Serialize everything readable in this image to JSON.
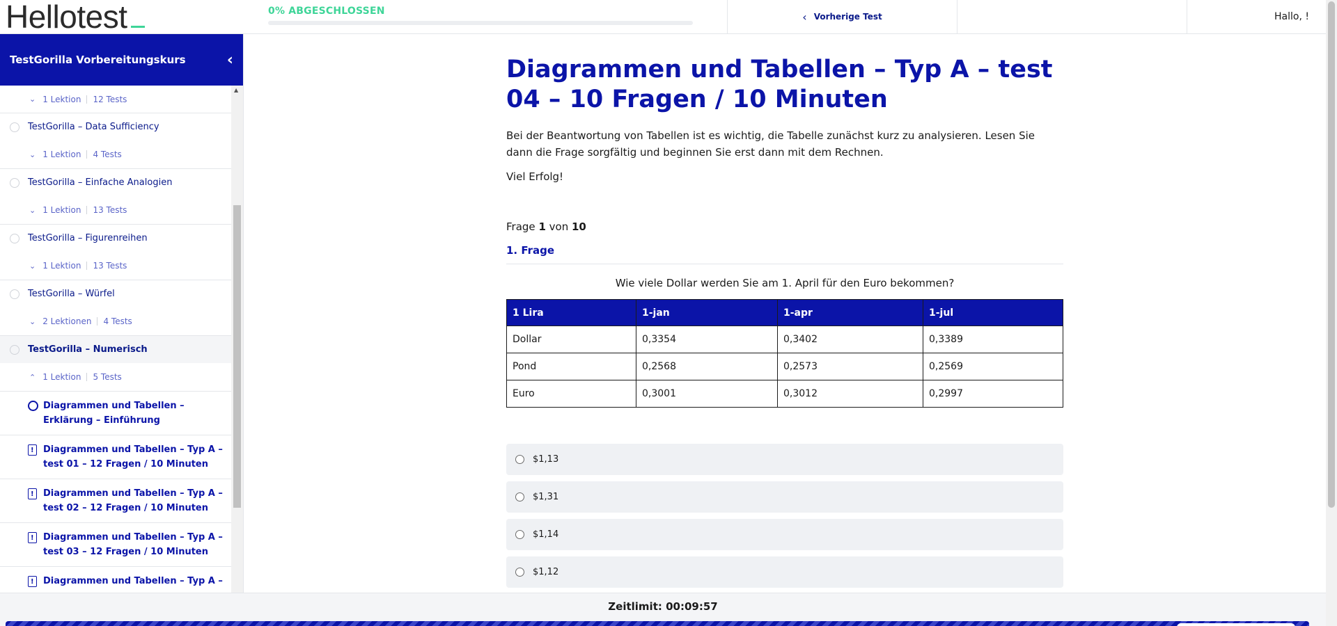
{
  "header": {
    "logo_text": "Hellotest",
    "progress_label": "0% ABGESCHLOSSEN",
    "progress_value": 0,
    "prev_test_label": "Vorherige Test",
    "greeting": "Hallo, !"
  },
  "sidebar": {
    "title": "TestGorilla Vorbereitungskurs",
    "first_meta": {
      "lessons": "1 Lektion",
      "tests": "12 Tests"
    },
    "sections": [
      {
        "title": "TestGorilla – Data Sufficiency",
        "lessons": "1 Lektion",
        "tests": "4 Tests"
      },
      {
        "title": "TestGorilla – Einfache Analogien",
        "lessons": "1 Lektion",
        "tests": "13 Tests"
      },
      {
        "title": "TestGorilla – Figurenreihen",
        "lessons": "1 Lektion",
        "tests": "13 Tests"
      },
      {
        "title": "TestGorilla – Würfel",
        "lessons": "2 Lektionen",
        "tests": "4 Tests"
      },
      {
        "title": "TestGorilla – Numerisch",
        "lessons": "1 Lektion",
        "tests": "5 Tests"
      }
    ],
    "lessons": [
      "Diagrammen und Tabellen – Erklärung – Einführung",
      "Diagrammen und Tabellen – Typ A – test 01 – 12 Fragen / 10 Minuten",
      "Diagrammen und Tabellen – Typ A – test 02 – 12 Fragen / 10 Minuten",
      "Diagrammen und Tabellen – Typ A – test 03 – 12 Fragen / 10 Minuten",
      "Diagrammen und Tabellen – Typ A –"
    ]
  },
  "main": {
    "title": "Diagrammen und Tabellen – Typ A – test 04 – 10 Fragen / 10 Minuten",
    "intro": "Bei der Beantwortung von Tabellen ist es wichtig, die Tabelle zunächst kurz zu analysieren. Lesen Sie dann die Frage sorgfältig und beginnen Sie erst dann mit dem Rechnen.",
    "good_luck": "Viel Erfolg!",
    "counter_prefix": "Frage",
    "counter_current": "1",
    "counter_mid": "von",
    "counter_total": "10",
    "question_heading": "1. Frage",
    "question_text": "Wie viele Dollar werden Sie am 1. April für den Euro bekommen?",
    "table": {
      "headers": [
        "1 Lira",
        "1-jan",
        "1-apr",
        "1-jul"
      ],
      "rows": [
        [
          "Dollar",
          "0,3354",
          "0,3402",
          "0,3389"
        ],
        [
          "Pond",
          "0,2568",
          "0,2573",
          "0,2569"
        ],
        [
          "Euro",
          "0,3001",
          "0,3012",
          "0,2997"
        ]
      ]
    },
    "answers": [
      "$1,13",
      "$1,31",
      "$1,14",
      "$1,12"
    ]
  },
  "footer": {
    "timer": "Zeitlimit: 00:09:57"
  },
  "colors": {
    "brand_blue": "#0b14a8",
    "accent_green": "#3ed598"
  }
}
